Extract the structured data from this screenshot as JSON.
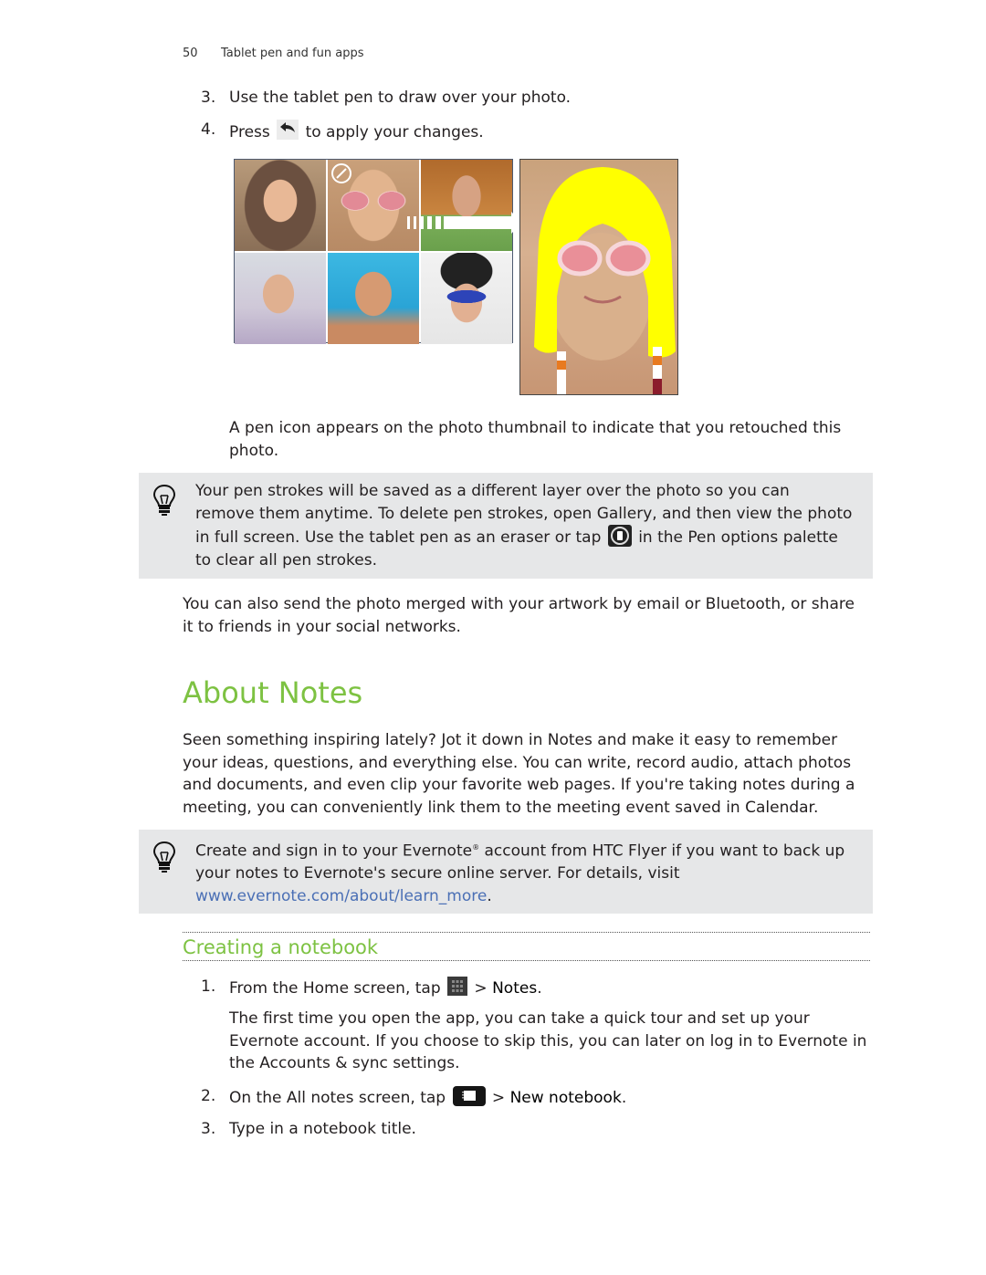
{
  "header": {
    "page_number": "50",
    "section": "Tablet pen and fun apps"
  },
  "steps_top": [
    {
      "n": "3.",
      "text": "Use the tablet pen to draw over your photo."
    },
    {
      "n": "4.",
      "pre": "Press",
      "icon": "back-arrow-icon",
      "post": "to apply your changes."
    }
  ],
  "figure": {
    "thumbnails": [
      "woman-fur-hood",
      "woman-pink-sunglasses-retouched",
      "bald-man-green-shirt",
      "man-striped-shirt",
      "man-pool",
      "woman-blue-sunglasses"
    ],
    "retouched_marker_icon": "pen-circle-icon",
    "arrow_icon": "right-arrow-icon",
    "result_photo": "woman-yellow-hair-drawing",
    "colors": {
      "pen_stroke": "#ffff00"
    }
  },
  "pen_icon_note": "A pen icon appears on the photo thumbnail to indicate that you retouched this photo.",
  "tip1": {
    "icon": "lightbulb-icon",
    "text_before": "Your pen strokes will be saved as a different layer over the photo so you can remove them anytime. To delete pen strokes, open Gallery, and then view the photo in full screen. Use the tablet pen as an eraser or tap",
    "inline_icon": "clear-strokes-icon",
    "text_after": "in the Pen options palette to clear all pen strokes."
  },
  "share_para": "You can also send the photo merged with your artwork by email or Bluetooth, or share it to friends in your social networks.",
  "section_title": "About Notes",
  "about_para": "Seen something inspiring lately? Jot it down in Notes and make it easy to remember your ideas, questions, and everything else. You can write, record audio, attach photos and documents, and even clip your favorite web pages. If you're taking notes during a meeting, you can conveniently link them to the meeting event saved in Calendar.",
  "tip2": {
    "icon": "lightbulb-icon",
    "text_a": "Create and sign in to your Evernote",
    "sup": "®",
    "text_b": " account from HTC Flyer if you want to back up your notes to Evernote's secure online server. For details, visit ",
    "link": "www.evernote.com/about/learn_more",
    "text_c": "."
  },
  "subsection_title": "Creating a notebook",
  "steps_notebook": [
    {
      "n": "1.",
      "pre": "From the Home screen, tap",
      "icon": "all-apps-grid-icon",
      "post_pre": " > ",
      "ui": "Notes",
      "post": "."
    },
    {
      "detail": "The first time you open the app, you can take a quick tour and set up your Evernote account. If you choose to skip this, you can later on log in to Evernote in the Accounts & sync settings."
    },
    {
      "n": "2.",
      "pre": "On the All notes screen, tap",
      "icon": "notebook-menu-icon",
      "post_pre": " > ",
      "ui": "New notebook",
      "post": "."
    },
    {
      "n": "3.",
      "text": "Type in a notebook title."
    }
  ],
  "colors": {
    "heading_green": "#7dc242",
    "link_blue": "#4a6fb5",
    "tip_bg": "#e6e7e8"
  }
}
